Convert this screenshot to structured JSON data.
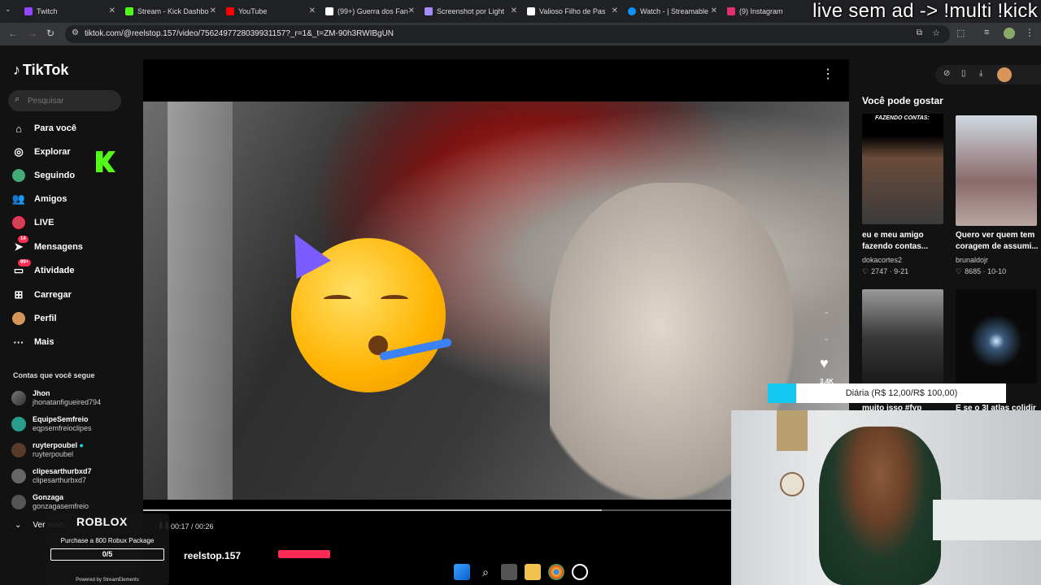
{
  "browser": {
    "tabs": [
      {
        "label": "Twitch",
        "color": "#9146ff"
      },
      {
        "label": "Stream - Kick Dashbo",
        "color": "#53fc18"
      },
      {
        "label": "YouTube",
        "color": "#ff0000"
      },
      {
        "label": "(99+) Guerra dos Fan",
        "color": "#ffffff"
      },
      {
        "label": "Screenshot por Light",
        "color": "#a78bfa"
      },
      {
        "label": "Valioso Filho de Pas",
        "color": "#ffffff"
      },
      {
        "label": "Watch - | Streamable",
        "color": "#0f90fa"
      },
      {
        "label": "(9) Instagram",
        "color": "#e1306c"
      }
    ],
    "url": "tiktok.com/@reelstop.157/video/7562497728039931157?_r=1&_t=ZM-90h3RWIBgUN"
  },
  "stream_overlay": {
    "top_text": "live sem ad -> !multi !kick",
    "goal_text": "Diária (R$ 12,00/R$ 100,00)",
    "goal_progress": 0.12,
    "roblox": {
      "logo": "ROBLOX",
      "package": "Purchase a 800 Robux Package",
      "count": "0/5",
      "powered": "Powered by StreamElements"
    }
  },
  "tiktok": {
    "logo": "TikTok",
    "search_placeholder": "Pesquisar",
    "nav": [
      {
        "label": "Para você",
        "icon": "home-icon"
      },
      {
        "label": "Explorar",
        "icon": "compass-icon"
      },
      {
        "label": "Seguindo",
        "icon": "following-icon"
      },
      {
        "label": "Amigos",
        "icon": "friends-icon"
      },
      {
        "label": "LIVE",
        "icon": "live-icon"
      },
      {
        "label": "Mensagens",
        "icon": "messages-icon",
        "badge": "14"
      },
      {
        "label": "Atividade",
        "icon": "activity-icon",
        "badge": "99+"
      },
      {
        "label": "Carregar",
        "icon": "upload-icon"
      },
      {
        "label": "Perfil",
        "icon": "profile-icon"
      },
      {
        "label": "Mais",
        "icon": "more-icon"
      }
    ],
    "following_heading": "Contas que você segue",
    "following": [
      {
        "name": "Jhon",
        "handle": "jhonatanfigueired794"
      },
      {
        "name": "EquipeSemfreio",
        "handle": "eqpsemfreioclipes"
      },
      {
        "name": "ruyterpoubel",
        "handle": "ruyterpoubel"
      },
      {
        "name": "clipesarthurbxd7",
        "handle": "clipesarthurbxd7"
      },
      {
        "name": "Gonzaga",
        "handle": "gonzagasemfreio"
      }
    ],
    "see_more": "Ver mais",
    "video": {
      "time": "00:17 / 00:26",
      "progress": 0.65,
      "author": "reelstop.157",
      "likes_partial": "3,4K"
    },
    "recommend_heading": "Você pode gostar",
    "recommendations": [
      {
        "caption": "eu e meu amigo fazendo contas...",
        "author": "dokacortes2",
        "stats": "2747 · 9-21",
        "thumb_text": "FAZENDO CONTAS:"
      },
      {
        "caption": "Quero ver quem tem coragem de assumi...",
        "author": "brunaldojr",
        "stats": "8685 · 10-10",
        "thumb_text": ""
      },
      {
        "caption": "muito isso #fyp",
        "author": "",
        "stats": "",
        "thumb_text": ""
      },
      {
        "caption": "E se o 3I atlas colidir",
        "author": "",
        "stats": "",
        "thumb_text": ""
      }
    ]
  },
  "colors": {
    "accent": "#fe2c55",
    "goal": "#14c8ef",
    "kick": "#53fc18"
  }
}
